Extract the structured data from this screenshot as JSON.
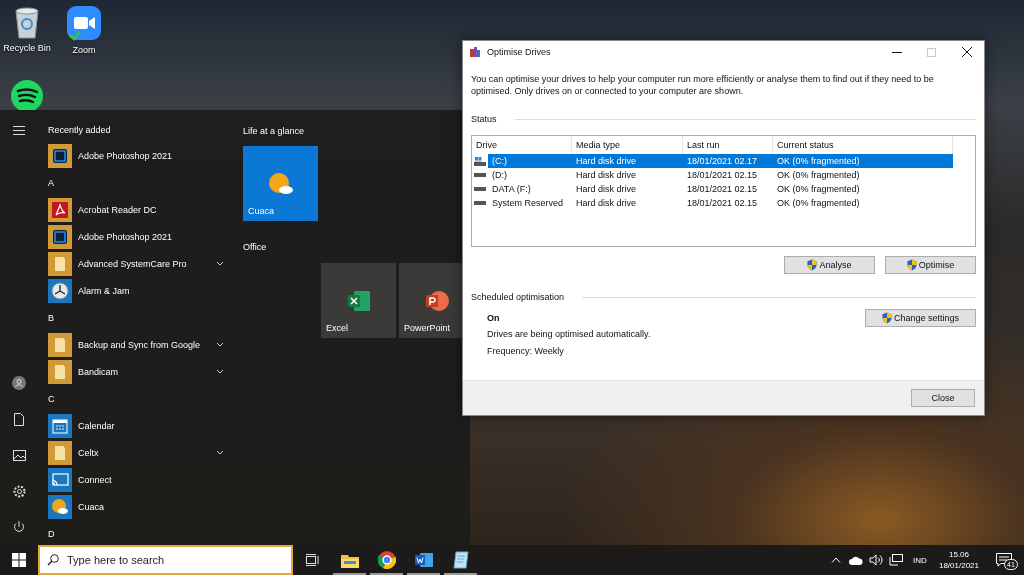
{
  "desktop_icons": [
    {
      "label": "Recycle Bin"
    },
    {
      "label": "Zoom"
    }
  ],
  "start_menu": {
    "list_header": "Recently added",
    "items": [
      {
        "kind": "app",
        "label": "Adobe Photoshop 2021"
      },
      {
        "kind": "letter",
        "label": "A"
      },
      {
        "kind": "app",
        "label": "Acrobat Reader DC"
      },
      {
        "kind": "app",
        "label": "Adobe Photoshop 2021"
      },
      {
        "kind": "folder",
        "label": "Advanced SystemCare Pro"
      },
      {
        "kind": "app",
        "label": "Alarm & Jam"
      },
      {
        "kind": "letter",
        "label": "B"
      },
      {
        "kind": "folder",
        "label": "Backup and Sync from Google"
      },
      {
        "kind": "folder",
        "label": "Bandicam"
      },
      {
        "kind": "letter",
        "label": "C"
      },
      {
        "kind": "app",
        "label": "Calendar"
      },
      {
        "kind": "folder",
        "label": "Celtx"
      },
      {
        "kind": "app",
        "label": "Connect"
      },
      {
        "kind": "app",
        "label": "Cuaca"
      },
      {
        "kind": "letter",
        "label": "D"
      }
    ],
    "tile_groups": [
      {
        "title": "Life at a glance",
        "tiles": [
          {
            "label": "Cuaca"
          }
        ]
      },
      {
        "title": "Office",
        "tiles": [
          {
            "label": "Excel"
          },
          {
            "label": "PowerPoint"
          }
        ]
      }
    ]
  },
  "dialog": {
    "title": "Optimise Drives",
    "description": "You can optimise your drives to help your computer run more efficiently or analyse them to find out if they need to be optimised. Only drives on or connected to your computer are shown.",
    "status_heading": "Status",
    "table": {
      "columns": [
        "Drive",
        "Media type",
        "Last run",
        "Current status"
      ],
      "rows": [
        {
          "drive": "(C:)",
          "media_type": "Hard disk drive",
          "last_run": "18/01/2021 02.17",
          "current_status": "OK (0% fragmented)",
          "selected": true
        },
        {
          "drive": "(D:)",
          "media_type": "Hard disk drive",
          "last_run": "18/01/2021 02.15",
          "current_status": "OK (0% fragmented)",
          "selected": false
        },
        {
          "drive": "DATA (F:)",
          "media_type": "Hard disk drive",
          "last_run": "18/01/2021 02.15",
          "current_status": "OK (0% fragmented)",
          "selected": false
        },
        {
          "drive": "System Reserved",
          "media_type": "Hard disk drive",
          "last_run": "18/01/2021 02.15",
          "current_status": "OK (0% fragmented)",
          "selected": false
        }
      ]
    },
    "actions": [
      "Analyse",
      "Optimise"
    ],
    "schedule": {
      "heading": "Scheduled optimisation",
      "state": "On",
      "description": "Drives are being optimised automatically.",
      "frequency": "Frequency: Weekly",
      "button": "Change settings"
    },
    "close_button": "Close"
  },
  "taskbar": {
    "search": {
      "placeholder": "Type here to search"
    },
    "pinned": [
      {
        "running": true
      },
      {
        "running": true
      },
      {
        "running": true
      },
      {
        "running": true
      }
    ],
    "language": "IND",
    "time": "15.06",
    "date": "18/01/2021",
    "notification_count": "41"
  }
}
